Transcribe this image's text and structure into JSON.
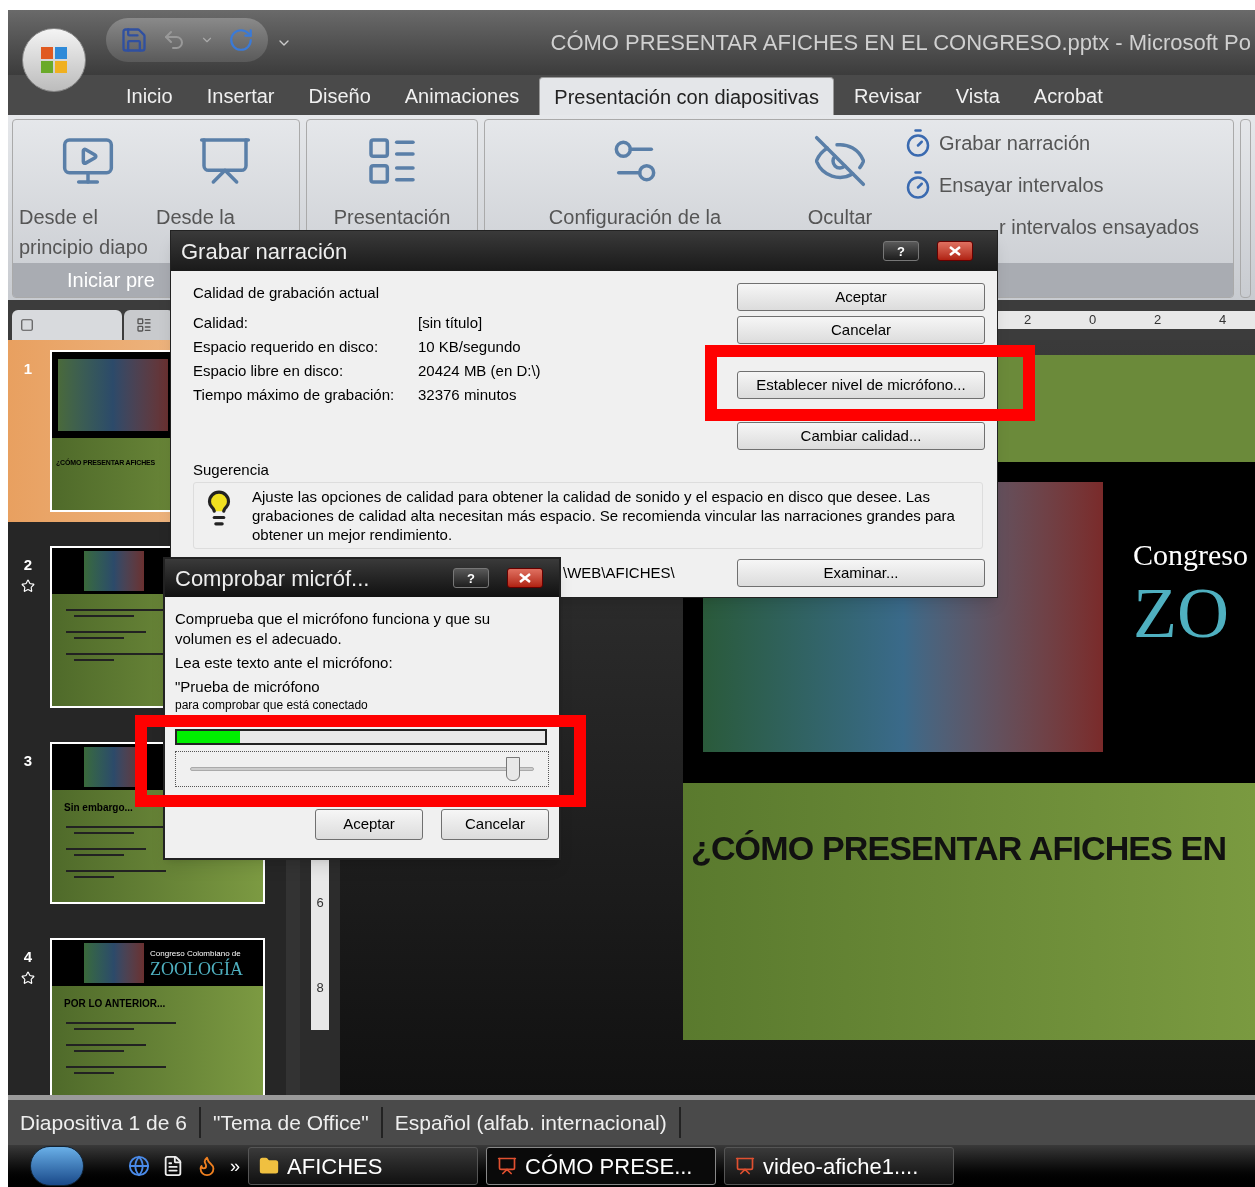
{
  "window": {
    "title": "CÓMO PRESENTAR AFICHES EN EL CONGRESO.pptx - Microsoft Po"
  },
  "ribbon_tabs": [
    {
      "label": "Inicio",
      "selected": false
    },
    {
      "label": "Insertar",
      "selected": false
    },
    {
      "label": "Diseño",
      "selected": false
    },
    {
      "label": "Animaciones",
      "selected": false
    },
    {
      "label": "Presentación con diapositivas",
      "selected": true
    },
    {
      "label": "Revisar",
      "selected": false
    },
    {
      "label": "Vista",
      "selected": false
    },
    {
      "label": "Acrobat",
      "selected": false
    }
  ],
  "ribbon": {
    "large_buttons": [
      {
        "lines": [
          "Desde el",
          "principio diapo"
        ]
      },
      {
        "lines": [
          "Desde la"
        ]
      },
      {
        "lines": [
          "Presentación"
        ]
      },
      {
        "lines": [
          "Configuración de la"
        ]
      },
      {
        "lines": [
          "Ocultar"
        ]
      }
    ],
    "small_buttons": [
      {
        "label": "Grabar narración"
      },
      {
        "label": "Ensayar intervalos"
      },
      {
        "label": "r intervalos ensayados"
      }
    ],
    "group_label": "Iniciar pre"
  },
  "ruler": {
    "horizontal": [
      "2",
      "0",
      "2",
      "4"
    ],
    "vertical": [
      "6",
      "8"
    ]
  },
  "slides": [
    {
      "number": "1",
      "selected": true,
      "animated": false,
      "kind": "title",
      "texts": [
        "¿CÓMO PRESENTAR AFICHES"
      ]
    },
    {
      "number": "2",
      "selected": false,
      "animated": true,
      "kind": "content"
    },
    {
      "number": "3",
      "selected": false,
      "animated": false,
      "kind": "content",
      "texts": [
        "Sin embargo..."
      ]
    },
    {
      "number": "4",
      "selected": false,
      "animated": true,
      "kind": "content",
      "texts": [
        "Congreso Colombiano de",
        "ZOOLOGÍA",
        "POR LO ANTERIOR..."
      ]
    }
  ],
  "current_slide": {
    "subtitle": "Congreso",
    "logo_text": "ZO",
    "title": "¿CÓMO PRESENTAR AFICHES EN"
  },
  "record_dialog": {
    "title": "Grabar narración",
    "help": "?",
    "heading": "Calidad de grabación actual",
    "rows": [
      {
        "label": "Calidad:",
        "value": "[sin título]"
      },
      {
        "label": "Espacio requerido en disco:",
        "value": "10 KB/segundo"
      },
      {
        "label": "Espacio libre en disco:",
        "value": "20424 MB (en D:\\)"
      },
      {
        "label": "Tiempo máximo de grabación:",
        "value": "32376 minutos"
      }
    ],
    "buttons": [
      "Aceptar",
      "Cancelar",
      "Establecer nivel de micrófono...",
      "Cambiar calidad..."
    ],
    "hint_label": "Sugerencia",
    "hint_text": "Ajuste las opciones de calidad para obtener la calidad de sonido y el espacio en disco que desee. Las grabaciones de calidad alta necesitan más espacio. Se recomienda vincular las narraciones grandes para obtener un mejor rendimiento.",
    "path": "\\WEB\\AFICHES\\",
    "browse_button": "Examinar..."
  },
  "mic_dialog": {
    "title": "Comprobar micróf...",
    "help": "?",
    "instruction": "Comprueba que el micrófono funciona y que su volumen es el adecuado.",
    "prompt": "Lea este texto ante el micrófono:",
    "sample_lines": [
      "\"Prueba de micrófono",
      "para comprobar que está conectado"
    ],
    "meter": {
      "level": 0.17
    },
    "volume": {
      "level": 0.96
    },
    "buttons": [
      "Aceptar",
      "Cancelar"
    ]
  },
  "status_bar": [
    "Diapositiva 1 de 6",
    "\"Tema de Office\"",
    "Español (alfab. internacional)"
  ],
  "taskbar": {
    "more": "»",
    "tasks": [
      {
        "label": "AFICHES",
        "kind": "folder",
        "selected": false
      },
      {
        "label": "CÓMO PRESE...",
        "kind": "presentation",
        "selected": true
      },
      {
        "label": "video-afiche1....",
        "kind": "presentation",
        "selected": false
      }
    ]
  }
}
